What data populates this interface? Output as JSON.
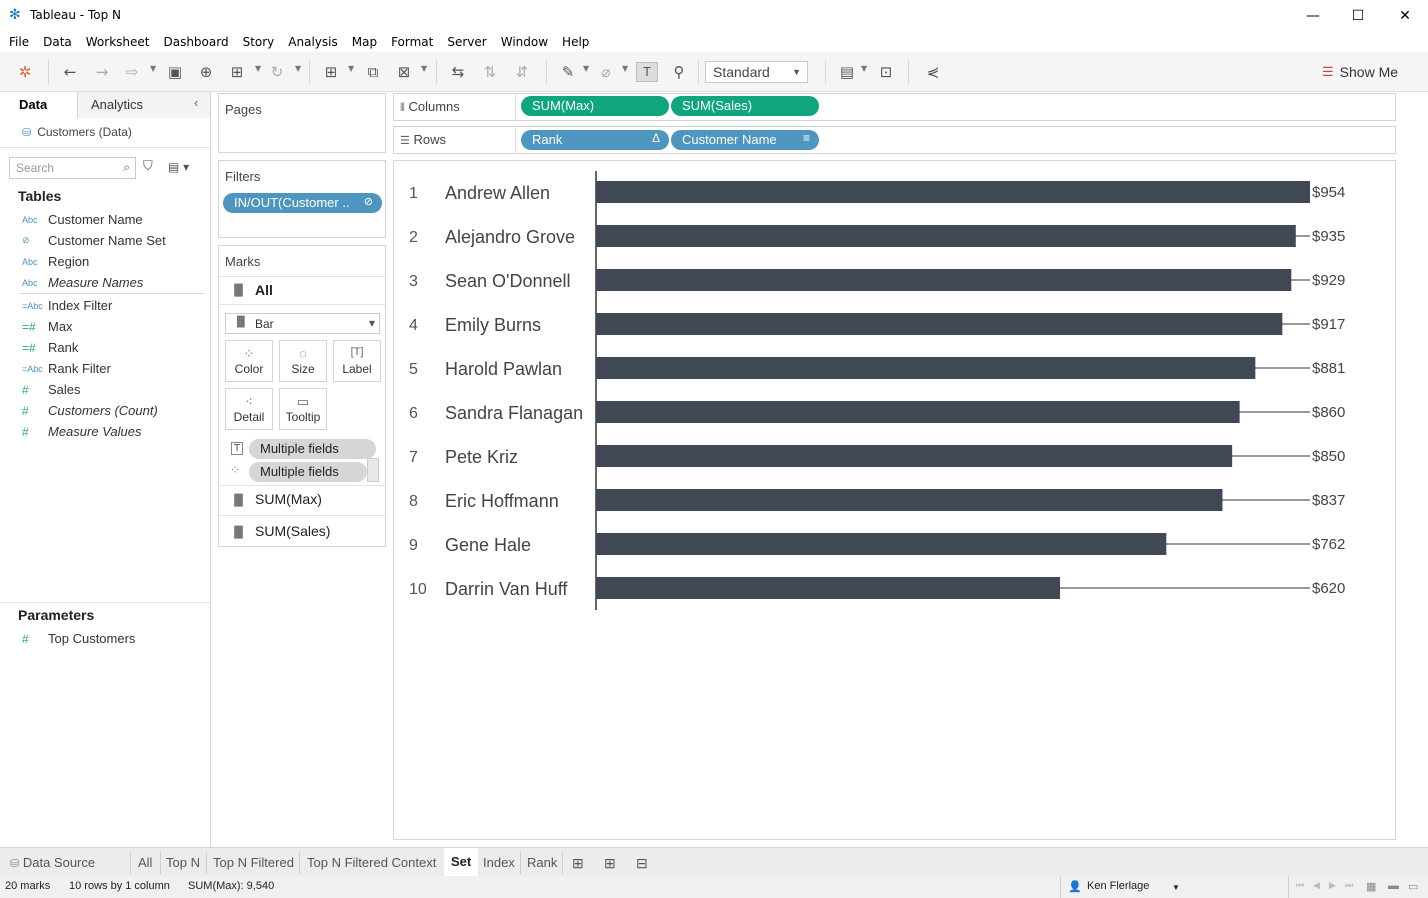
{
  "window": {
    "title": "Tableau - Top N"
  },
  "menu": [
    "File",
    "Data",
    "Worksheet",
    "Dashboard",
    "Story",
    "Analysis",
    "Map",
    "Format",
    "Server",
    "Window",
    "Help"
  ],
  "toolbar": {
    "fit": "Standard",
    "show_me": "Show Me"
  },
  "data_pane": {
    "tabs": [
      "Data",
      "Analytics"
    ],
    "datasource": "Customers (Data)",
    "search_placeholder": "Search",
    "tables_heading": "Tables",
    "fields": [
      {
        "icon": "Abc",
        "name": "Customer Name",
        "italic": false,
        "type": "dim"
      },
      {
        "icon": "set",
        "name": "Customer Name Set",
        "italic": false,
        "type": "dim"
      },
      {
        "icon": "Abc",
        "name": "Region",
        "italic": false,
        "type": "dim"
      },
      {
        "icon": "Abc",
        "name": "Measure Names",
        "italic": true,
        "type": "dim"
      },
      {
        "icon": "=Abc",
        "name": "Index Filter",
        "italic": false,
        "type": "dim"
      },
      {
        "icon": "=#",
        "name": "Max",
        "italic": false,
        "type": "meas"
      },
      {
        "icon": "=#",
        "name": "Rank",
        "italic": false,
        "type": "meas"
      },
      {
        "icon": "=Abc",
        "name": "Rank Filter",
        "italic": false,
        "type": "dim"
      },
      {
        "icon": "#",
        "name": "Sales",
        "italic": false,
        "type": "meas"
      },
      {
        "icon": "#",
        "name": "Customers (Count)",
        "italic": true,
        "type": "meas"
      },
      {
        "icon": "#",
        "name": "Measure Values",
        "italic": true,
        "type": "meas"
      }
    ],
    "parameters_heading": "Parameters",
    "parameters": [
      {
        "icon": "#",
        "name": "Top Customers"
      }
    ]
  },
  "cards": {
    "pages": "Pages",
    "filters": "Filters",
    "filter_pill": "IN/OUT(Customer ..",
    "marks": "Marks",
    "marks_all": "All",
    "mark_type": "Bar",
    "mark_buttons": [
      "Color",
      "Size",
      "Label",
      "Detail",
      "Tooltip"
    ],
    "mark_fields": [
      "Multiple fields",
      "Multiple fields"
    ],
    "marks_sub": [
      "SUM(Max)",
      "SUM(Sales)"
    ]
  },
  "shelves": {
    "columns_label": "Columns",
    "columns": [
      "SUM(Max)",
      "SUM(Sales)"
    ],
    "rows_label": "Rows",
    "rows": [
      "Rank",
      "Customer Name"
    ]
  },
  "chart_data": {
    "type": "bar",
    "categories": [
      "Andrew Allen",
      "Alejandro Grove",
      "Sean O'Donnell",
      "Emily Burns",
      "Harold Pawlan",
      "Sandra Flanagan",
      "Pete Kriz",
      "Eric Hoffmann",
      "Gene Hale",
      "Darrin Van Huff"
    ],
    "ranks": [
      "1",
      "2",
      "3",
      "4",
      "5",
      "6",
      "7",
      "8",
      "9",
      "10"
    ],
    "values": [
      954,
      935,
      929,
      917,
      881,
      860,
      850,
      837,
      762,
      620
    ],
    "value_labels": [
      "$954",
      "$935",
      "$929",
      "$917",
      "$881",
      "$860",
      "$850",
      "$837",
      "$762",
      "$620"
    ],
    "max": 954,
    "bar_color": "#404856"
  },
  "sheet_tabs": [
    "Data Source",
    "All",
    "Top N",
    "Top N Filtered",
    "Top N Filtered Context",
    "Set",
    "Index",
    "Rank"
  ],
  "active_tab": "Set",
  "status": {
    "marks": "20 marks",
    "rows": "10 rows by 1 column",
    "sum": "SUM(Max): 9,540",
    "user": "Ken Flerlage"
  }
}
